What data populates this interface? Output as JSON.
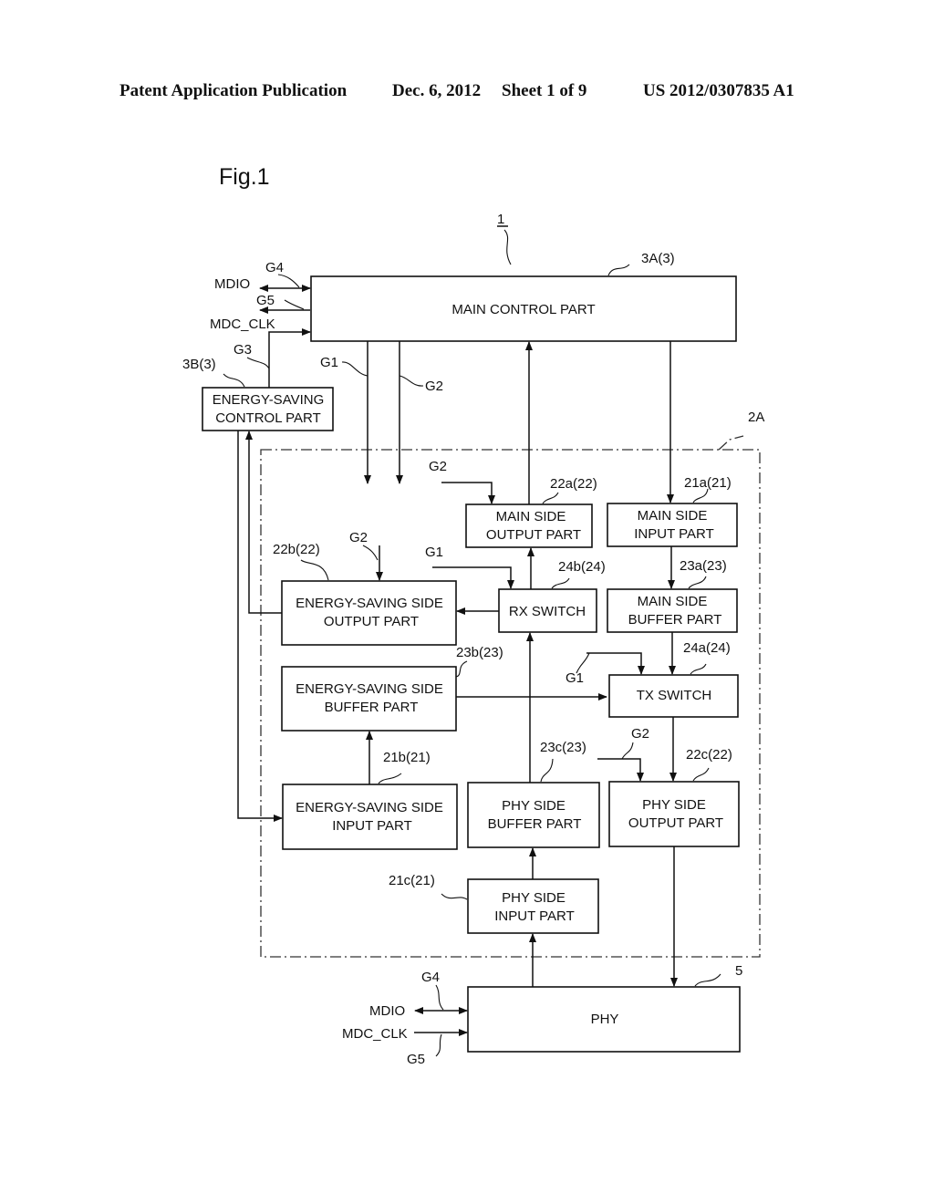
{
  "header": {
    "publication": "Patent Application Publication",
    "date": "Dec. 6, 2012",
    "sheet": "Sheet 1 of 9",
    "number": "US 2012/0307835 A1"
  },
  "figure": {
    "title": "Fig.1",
    "ref_system": "1",
    "ref_interface_group": "2A",
    "blocks": {
      "main_control": {
        "label1": "MAIN CONTROL PART",
        "ref": "3A(3)"
      },
      "energy_control": {
        "label1": "ENERGY-SAVING",
        "label2": "CONTROL PART",
        "ref": "3B(3)"
      },
      "main_side_output": {
        "label1": "MAIN SIDE",
        "label2": "OUTPUT PART",
        "ref": "22a(22)"
      },
      "main_side_input": {
        "label1": "MAIN SIDE",
        "label2": "INPUT PART",
        "ref": "21a(21)"
      },
      "es_side_output": {
        "label1": "ENERGY-SAVING  SIDE",
        "label2": "OUTPUT PART",
        "ref": "22b(22)"
      },
      "rx_switch": {
        "label1": "RX SWITCH",
        "ref": "24b(24)"
      },
      "main_side_buffer": {
        "label1": "MAIN SIDE",
        "label2": "BUFFER PART",
        "ref": "23a(23)"
      },
      "es_side_buffer": {
        "label1": "ENERGY-SAVING  SIDE",
        "label2": "BUFFER PART",
        "ref": "23b(23)"
      },
      "tx_switch": {
        "label1": "TX SWITCH",
        "ref": "24a(24)"
      },
      "es_side_input": {
        "label1": "ENERGY-SAVING  SIDE",
        "label2": "INPUT PART",
        "ref": "21b(21)"
      },
      "phy_side_buffer": {
        "label1": "PHY SIDE",
        "label2": "BUFFER PART",
        "ref": "23c(23)"
      },
      "phy_side_output": {
        "label1": "PHY SIDE",
        "label2": "OUTPUT PART",
        "ref": "22c(22)"
      },
      "phy_side_input": {
        "label1": "PHY SIDE",
        "label2": "INPUT PART",
        "ref": "21c(21)"
      },
      "phy": {
        "label1": "PHY",
        "ref": "5"
      }
    },
    "signals": {
      "g1": "G1",
      "g2": "G2",
      "g3": "G3",
      "g4": "G4",
      "g5": "G5",
      "mdio": "MDIO",
      "mdc_clk": "MDC_CLK"
    }
  }
}
